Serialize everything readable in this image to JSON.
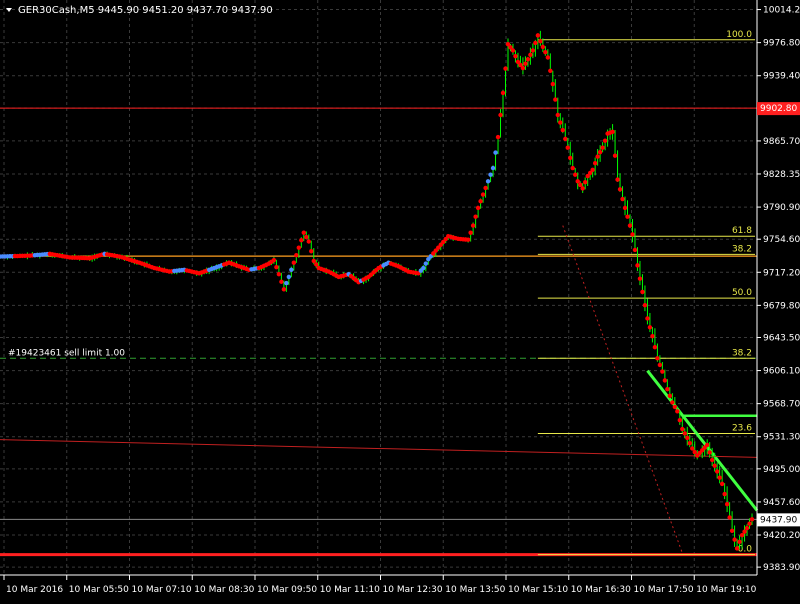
{
  "window": {
    "symbol_line": "GER30Cash,M5  9445.90 9451.20 9437.70 9437.90",
    "order_label": "#19423461 sell limit 1.00",
    "current_price_label": "9437.90",
    "red_line_label": "9902.80"
  },
  "colors": {
    "background": "#000000",
    "grid": "#3a3a3a",
    "axis_text": "#ffffff",
    "bull_candle": "#00ff00",
    "bear_candle": "#00ff00",
    "dot_up": "#ff0000",
    "dot_down": "#4a8cff",
    "fib_line": "#e8e84a",
    "fib_text": "#e8e84a",
    "red_line": "#ff2020",
    "orange_line": "#ffa020",
    "trend_line": "#40ff40",
    "order_line": "#30a030"
  },
  "chart_data": {
    "type": "candlestick",
    "symbol": "GER30Cash",
    "timeframe": "M5",
    "ohlc_header": {
      "open": 9445.9,
      "high": 9451.2,
      "low": 9437.7,
      "close": 9437.9
    },
    "ylim": [
      9375,
      10025
    ],
    "y_ticks": [
      "10014.20",
      "9976.80",
      "9939.40",
      "9902.80",
      "9865.70",
      "9828.35",
      "9790.90",
      "9754.60",
      "9717.20",
      "9679.80",
      "9643.50",
      "9606.10",
      "9568.70",
      "9531.30",
      "9495.00",
      "9457.60",
      "9420.20",
      "9383.90"
    ],
    "x_ticks": [
      "10 Mar 2016",
      "10 Mar 05:50",
      "10 Mar 07:10",
      "10 Mar 08:30",
      "10 Mar 09:50",
      "10 Mar 11:10",
      "10 Mar 12:30",
      "10 Mar 13:50",
      "10 Mar 15:10",
      "10 Mar 16:30",
      "10 Mar 17:50",
      "10 Mar 19:10"
    ],
    "price_path": [
      [
        0,
        9735
      ],
      [
        6,
        9736
      ],
      [
        10,
        9738
      ],
      [
        14,
        9734
      ],
      [
        18,
        9733
      ],
      [
        21,
        9738
      ],
      [
        24,
        9735
      ],
      [
        28,
        9728
      ],
      [
        31,
        9722
      ],
      [
        34,
        9718
      ],
      [
        37,
        9720
      ],
      [
        40,
        9716
      ],
      [
        43,
        9722
      ],
      [
        46,
        9728
      ],
      [
        48,
        9724
      ],
      [
        50,
        9720
      ],
      [
        52,
        9722
      ],
      [
        54,
        9727
      ],
      [
        55,
        9731
      ],
      [
        56,
        9715
      ],
      [
        57,
        9698
      ],
      [
        58,
        9712
      ],
      [
        59,
        9728
      ],
      [
        60,
        9745
      ],
      [
        61,
        9762
      ],
      [
        62,
        9752
      ],
      [
        63,
        9730
      ],
      [
        64,
        9722
      ],
      [
        66,
        9718
      ],
      [
        68,
        9712
      ],
      [
        70,
        9715
      ],
      [
        72,
        9706
      ],
      [
        74,
        9712
      ],
      [
        76,
        9722
      ],
      [
        78,
        9728
      ],
      [
        80,
        9724
      ],
      [
        82,
        9718
      ],
      [
        84,
        9716
      ],
      [
        85,
        9722
      ],
      [
        86,
        9732
      ],
      [
        88,
        9745
      ],
      [
        90,
        9758
      ],
      [
        92,
        9755
      ],
      [
        94,
        9754
      ],
      [
        95,
        9770
      ],
      [
        96,
        9790
      ],
      [
        97,
        9805
      ],
      [
        98,
        9820
      ],
      [
        99,
        9835
      ],
      [
        100,
        9870
      ],
      [
        101,
        9920
      ],
      [
        102,
        9975
      ],
      [
        103,
        9968
      ],
      [
        104,
        9955
      ],
      [
        105,
        9948
      ],
      [
        106,
        9958
      ],
      [
        107,
        9968
      ],
      [
        108,
        9985
      ],
      [
        109,
        9972
      ],
      [
        110,
        9960
      ],
      [
        111,
        9930
      ],
      [
        112,
        9895
      ],
      [
        113,
        9878
      ],
      [
        114,
        9858
      ],
      [
        115,
        9835
      ],
      [
        116,
        9820
      ],
      [
        117,
        9812
      ],
      [
        118,
        9826
      ],
      [
        119,
        9833
      ],
      [
        120,
        9848
      ],
      [
        121,
        9858
      ],
      [
        122,
        9874
      ],
      [
        123,
        9876
      ],
      [
        124,
        9822
      ],
      [
        125,
        9800
      ],
      [
        126,
        9780
      ],
      [
        127,
        9760
      ],
      [
        128,
        9725
      ],
      [
        129,
        9695
      ],
      [
        130,
        9665
      ],
      [
        131,
        9645
      ],
      [
        132,
        9620
      ],
      [
        133,
        9605
      ],
      [
        134,
        9585
      ],
      [
        135,
        9570
      ],
      [
        136,
        9560
      ],
      [
        137,
        9540
      ],
      [
        138,
        9530
      ],
      [
        139,
        9518
      ],
      [
        140,
        9510
      ],
      [
        141,
        9516
      ],
      [
        142,
        9522
      ],
      [
        143,
        9505
      ],
      [
        144,
        9492
      ],
      [
        145,
        9478
      ],
      [
        146,
        9455
      ],
      [
        147,
        9425
      ],
      [
        148,
        9405
      ],
      [
        149,
        9420
      ],
      [
        150,
        9428
      ],
      [
        151,
        9438
      ]
    ],
    "horizontal_lines": [
      {
        "label": "9902.80",
        "price": 9902.8,
        "kind": "red"
      },
      {
        "label": "",
        "price": 9735.5,
        "kind": "orange"
      },
      {
        "label": "",
        "price": 9398.0,
        "kind": "red-bold"
      },
      {
        "label": "#19423461 sell limit 1.00",
        "price": 9620.0,
        "kind": "order"
      },
      {
        "label": "9437.90",
        "price": 9437.9,
        "kind": "current"
      }
    ],
    "fibonacci": {
      "high": 9980.0,
      "low": 9398.0,
      "levels": [
        {
          "label": "100.0",
          "price": 9980.0
        },
        {
          "label": "61.8",
          "price": 9758.0
        },
        {
          "label": "38.2",
          "price": 9737.5
        },
        {
          "label": "50.0",
          "price": 9688.0
        },
        {
          "label": "38.2",
          "price": 9620.0
        },
        {
          "label": "23.6",
          "price": 9535.0
        },
        {
          "label": "0.0",
          "price": 9398.0
        }
      ]
    },
    "trend_lines": [
      {
        "from": [
          130,
          9606
        ],
        "to": [
          152,
          9448
        ],
        "kind": "green"
      },
      {
        "from": [
          0,
          9528
        ],
        "to": [
          152,
          9508
        ],
        "kind": "red-thin"
      },
      {
        "from": [
          113,
          9770
        ],
        "to": [
          137,
          9400
        ],
        "kind": "red-dotted"
      }
    ],
    "resistance_segment": {
      "from": [
        137,
        9555
      ],
      "to": [
        152,
        9555
      ]
    },
    "grid": true
  }
}
